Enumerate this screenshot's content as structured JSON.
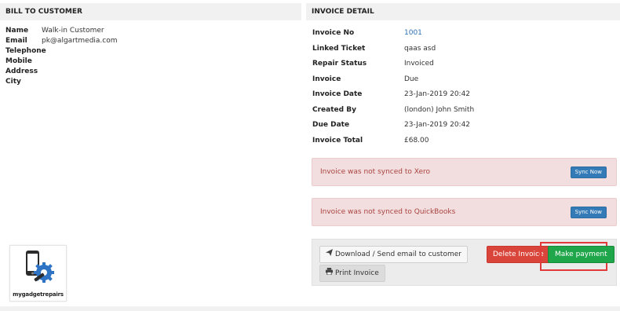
{
  "bill_to": {
    "heading": "BILL TO CUSTOMER",
    "rows": [
      {
        "label": "Name",
        "value": "Walk-in Customer"
      },
      {
        "label": "Email",
        "value": "pk@algartmedia.com"
      },
      {
        "label": "Telephone",
        "value": ""
      },
      {
        "label": "Mobile",
        "value": ""
      },
      {
        "label": "Address",
        "value": ""
      },
      {
        "label": "City",
        "value": ""
      }
    ]
  },
  "invoice_detail": {
    "heading": "INVOICE DETAIL",
    "rows": [
      {
        "label": "Invoice No",
        "value": "1001"
      },
      {
        "label": "Linked Ticket",
        "value": "qaas asd"
      },
      {
        "label": "Repair Status",
        "value": "Invoiced"
      },
      {
        "label": "Invoice",
        "value": "Due"
      },
      {
        "label": "Invoice Date",
        "value": "23-Jan-2019 20:42"
      },
      {
        "label": "Created By",
        "value": "(london) John Smith"
      },
      {
        "label": "Due Date",
        "value": "23-Jan-2019 20:42"
      },
      {
        "label": "Invoice Total",
        "value": "£68.00"
      }
    ]
  },
  "alerts": {
    "xero": {
      "text": "Invoice was not synced to Xero",
      "button": "Sync Now"
    },
    "quickbooks": {
      "text": "Invoice was not synced to QuickBooks",
      "button": "Sync Now"
    }
  },
  "actions": {
    "download": {
      "label": "Download / Send email to customer",
      "icon": "paper-plane-icon"
    },
    "print": {
      "label": "Print Invoice",
      "icon": "print-icon"
    },
    "delete": {
      "label": "Delete Invoice"
    },
    "pay": {
      "label": "Make payment"
    }
  },
  "logo": {
    "text": "mygadgetrepairs"
  },
  "colors": {
    "link": "#2a6fb3",
    "alert_bg": "#f2dede",
    "alert_text": "#a94442",
    "sync_button": "#337ab7",
    "danger": "#d9453a",
    "success": "#1fa64a",
    "highlight": "#e03a3a"
  }
}
